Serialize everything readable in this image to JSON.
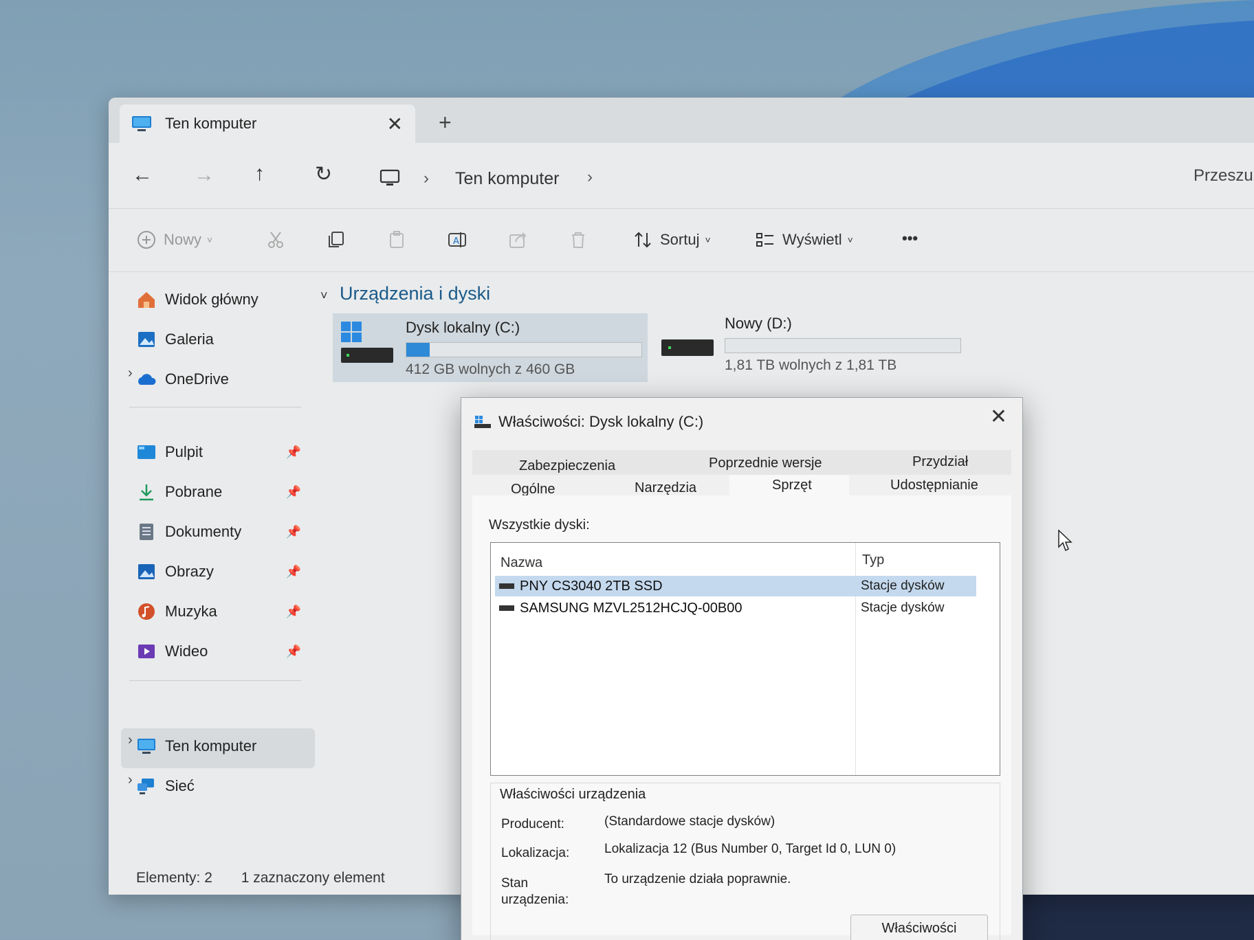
{
  "explorer": {
    "tab_title": "Ten komputer",
    "tab_close": "✕",
    "tab_new": "+",
    "address": {
      "crumb": "Ten komputer",
      "search_placeholder": "Przeszuk"
    },
    "toolbar": {
      "new_label": "Nowy",
      "sort_label": "Sortuj",
      "view_label": "Wyświetl",
      "more_label": "•••"
    },
    "sidebar": {
      "items": [
        {
          "label": "Widok główny"
        },
        {
          "label": "Galeria"
        },
        {
          "label": "OneDrive"
        },
        {
          "label": "Pulpit"
        },
        {
          "label": "Pobrane"
        },
        {
          "label": "Dokumenty"
        },
        {
          "label": "Obrazy"
        },
        {
          "label": "Muzyka"
        },
        {
          "label": "Wideo"
        },
        {
          "label": "Ten komputer"
        },
        {
          "label": "Sieć"
        }
      ]
    },
    "content": {
      "group_title": "Urządzenia i dyski",
      "drives": [
        {
          "name": "Dysk lokalny (C:)",
          "free_text": "412 GB wolnych z 460 GB",
          "used_fraction": 0.1
        },
        {
          "name": "Nowy (D:)",
          "free_text": "1,81 TB wolnych z 1,81 TB",
          "used_fraction": 0.0
        }
      ]
    },
    "status": {
      "items": "Elementy: 2",
      "selected": "1 zaznaczony element"
    }
  },
  "dialog": {
    "title": "Właściwości: Dysk lokalny (C:)",
    "close": "✕",
    "tabs_row1": [
      "Zabezpieczenia",
      "Poprzednie wersje",
      "Przydział"
    ],
    "tabs_row2": [
      "Ogólne",
      "Narzędzia",
      "Sprzęt",
      "Udostępnianie"
    ],
    "active_tab": "Sprzęt",
    "all_disks_label": "Wszystkie dyski:",
    "columns": {
      "name": "Nazwa",
      "type": "Typ"
    },
    "disks": [
      {
        "name": "PNY CS3040 2TB SSD",
        "type": "Stacje dysków"
      },
      {
        "name": "SAMSUNG MZVL2512HCJQ-00B00",
        "type": "Stacje dysków"
      }
    ],
    "device_props": {
      "group_title": "Właściwości urządzenia",
      "manufacturer_label": "Producent:",
      "manufacturer_value": "(Standardowe stacje dysków)",
      "location_label": "Lokalizacja:",
      "location_value": "Lokalizacja 12 (Bus Number 0, Target Id 0, LUN 0)",
      "status_label_1": "Stan",
      "status_label_2": "urządzenia:",
      "status_value": "To urządzenie działa poprawnie.",
      "properties_button": "Właściwości"
    }
  },
  "colors": {
    "accent": "#2e8ad6",
    "selection": "#c4d9ee"
  }
}
